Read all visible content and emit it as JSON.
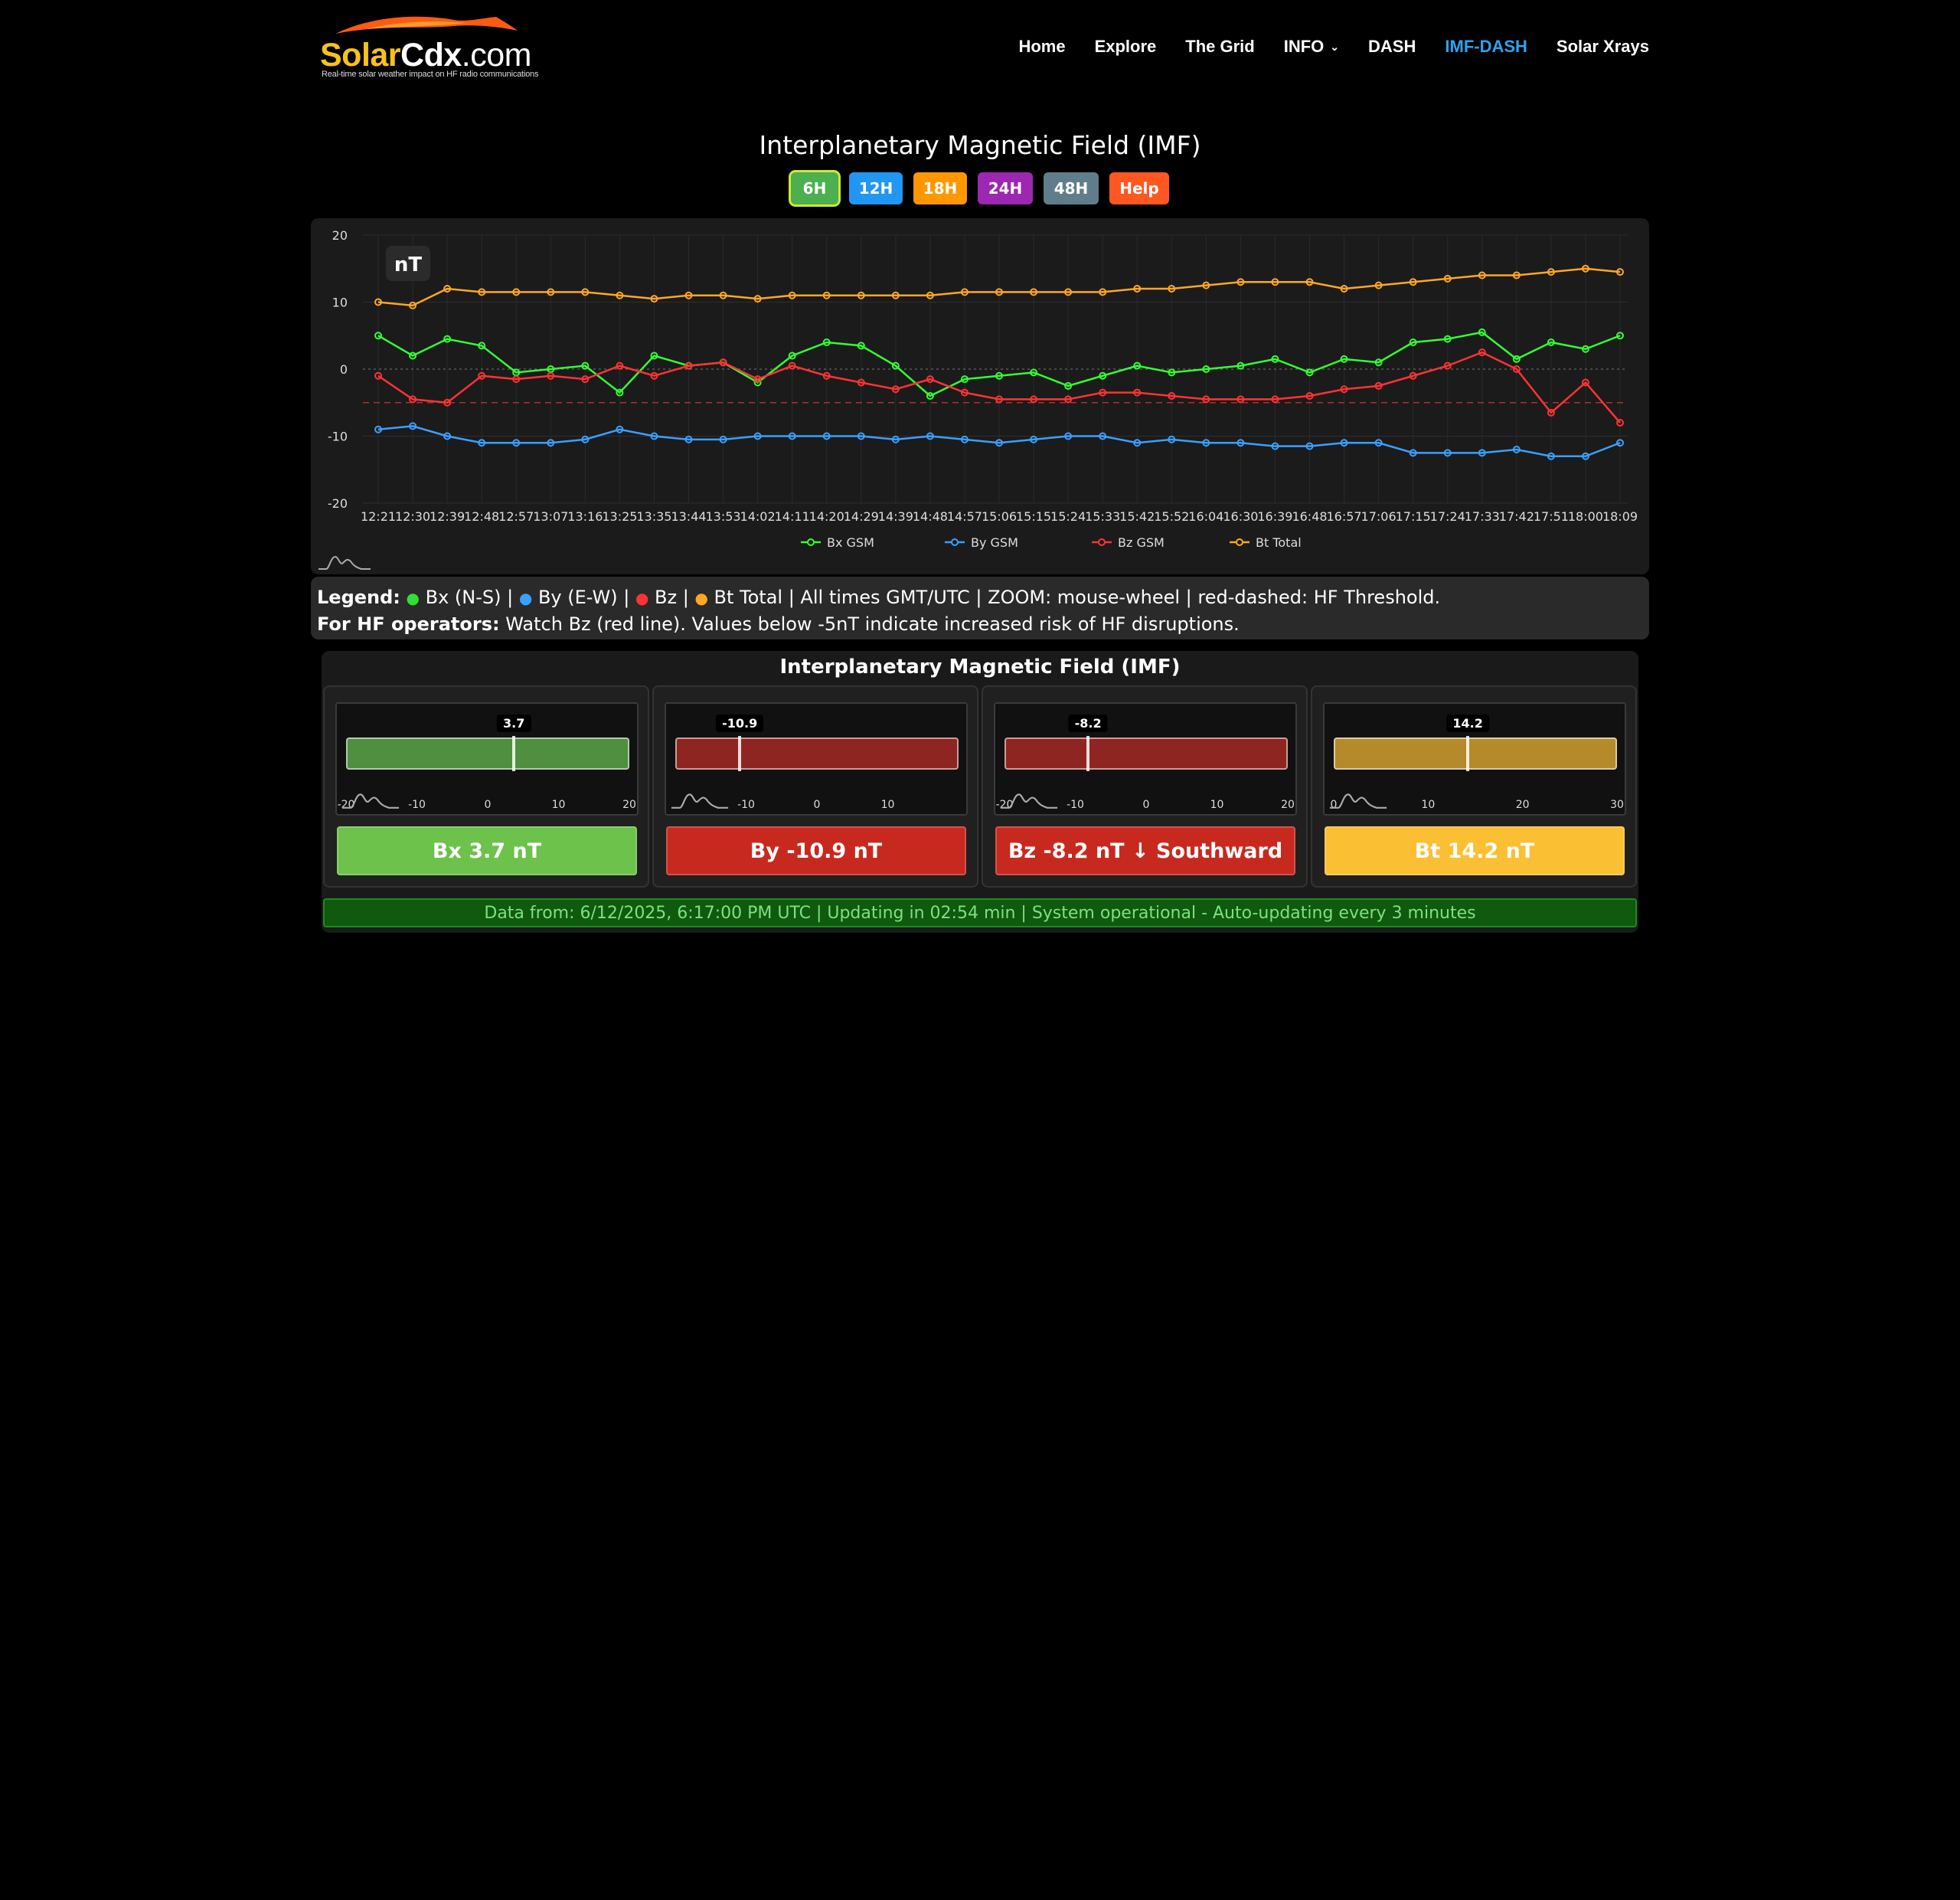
{
  "header": {
    "logo": {
      "solar": "Solar",
      "cdx": "Cdx",
      "com": ".com",
      "tagline": "Real-time solar weather impact on HF radio communications"
    },
    "nav": [
      {
        "label": "Home"
      },
      {
        "label": "Explore"
      },
      {
        "label": "The Grid"
      },
      {
        "label": "INFO"
      },
      {
        "label": "DASH"
      },
      {
        "label": "IMF-DASH",
        "active": true
      },
      {
        "label": "Solar Xrays"
      }
    ]
  },
  "page_title": "Interplanetary Magnetic Field (IMF)",
  "range_buttons": [
    {
      "label": "6H",
      "color": "#4caf50",
      "active": true
    },
    {
      "label": "12H",
      "color": "#2196f3"
    },
    {
      "label": "18H",
      "color": "#ff9800"
    },
    {
      "label": "24H",
      "color": "#9c27b0"
    },
    {
      "label": "48H",
      "color": "#607d8b"
    },
    {
      "label": "Help",
      "color": "#ff5722"
    }
  ],
  "chart_data": {
    "type": "line",
    "ylabel": "nT",
    "ylim": [
      -20,
      20
    ],
    "yticks": [
      20,
      10,
      0,
      -10,
      -20
    ],
    "hf_threshold": -5,
    "x": [
      "12:21",
      "12:30",
      "12:39",
      "12:48",
      "12:57",
      "13:07",
      "13:16",
      "13:25",
      "13:35",
      "13:44",
      "13:53",
      "14:02",
      "14:11",
      "14:20",
      "14:29",
      "14:39",
      "14:48",
      "14:57",
      "15:06",
      "15:15",
      "15:24",
      "15:33",
      "15:42",
      "15:52",
      "16:04",
      "16:30",
      "16:39",
      "16:48",
      "16:57",
      "17:06",
      "17:15",
      "17:24",
      "17:33",
      "17:42",
      "17:51",
      "18:00",
      "18:09"
    ],
    "series": [
      {
        "name": "Bx GSM",
        "color": "#33ff33",
        "values": [
          5.0,
          2.0,
          4.5,
          3.5,
          -0.5,
          0.0,
          0.5,
          -3.5,
          2.0,
          0.5,
          1.0,
          -2.0,
          2.0,
          4.0,
          3.5,
          0.5,
          -4.0,
          -1.5,
          -1.0,
          -0.5,
          -2.5,
          -1.0,
          0.5,
          -0.5,
          0.0,
          0.5,
          1.5,
          -0.5,
          1.5,
          1.0,
          4.0,
          4.5,
          5.5,
          1.5,
          4.0,
          3.0,
          5.0
        ]
      },
      {
        "name": "By GSM",
        "color": "#3aa0ff",
        "values": [
          -9.0,
          -8.5,
          -10.0,
          -11.0,
          -11.0,
          -11.0,
          -10.5,
          -9.0,
          -10.0,
          -10.5,
          -10.5,
          -10.0,
          -10.0,
          -10.0,
          -10.0,
          -10.5,
          -10.0,
          -10.5,
          -11.0,
          -10.5,
          -10.0,
          -10.0,
          -11.0,
          -10.5,
          -11.0,
          -11.0,
          -11.5,
          -11.5,
          -11.0,
          -11.0,
          -12.5,
          -12.5,
          -12.5,
          -12.0,
          -13.0,
          -13.0,
          -11.0
        ]
      },
      {
        "name": "Bz GSM",
        "color": "#ff3333",
        "values": [
          -1.0,
          -4.5,
          -5.0,
          -1.0,
          -1.5,
          -1.0,
          -1.5,
          0.5,
          -1.0,
          0.5,
          1.0,
          -1.5,
          0.5,
          -1.0,
          -2.0,
          -3.0,
          -1.5,
          -3.5,
          -4.5,
          -4.5,
          -4.5,
          -3.5,
          -3.5,
          -4.0,
          -4.5,
          -4.5,
          -4.5,
          -4.0,
          -3.0,
          -2.5,
          -1.0,
          0.5,
          2.5,
          0.0,
          -6.5,
          -2.0,
          -8.0
        ]
      },
      {
        "name": "Bt Total",
        "color": "#ffa726",
        "values": [
          10.0,
          9.5,
          12.0,
          11.5,
          11.5,
          11.5,
          11.5,
          11.0,
          10.5,
          11.0,
          11.0,
          10.5,
          11.0,
          11.0,
          11.0,
          11.0,
          11.0,
          11.5,
          11.5,
          11.5,
          11.5,
          11.5,
          12.0,
          12.0,
          12.5,
          13.0,
          13.0,
          13.0,
          12.0,
          12.5,
          13.0,
          13.5,
          14.0,
          14.0,
          14.5,
          15.0,
          14.5
        ]
      }
    ]
  },
  "legend_box": {
    "line1_label": "Legend:",
    "bx": "Bx (N-S) |",
    "by": "By (E-W) |",
    "bz": "Bz |",
    "rest": "Bt Total | All times GMT/UTC | ZOOM: mouse-wheel | red-dashed: HF Threshold.",
    "line2_label": "For HF operators:",
    "line2_text": "Watch Bz (red line). Values below -5nT indicate increased risk of HF disruptions."
  },
  "gauges": {
    "title": "Interplanetary Magnetic Field (IMF)",
    "items": [
      {
        "value": 3.7,
        "value_label": "3.7",
        "min": -20,
        "max": 20,
        "ticks": [
          "-20",
          "-10",
          "0",
          "10",
          "20"
        ],
        "tick_values": [
          -20,
          -10,
          0,
          10,
          20
        ],
        "bar_color": "#4f8f3f",
        "status": "Bx 3.7 nT",
        "status_bg": "#6cc24a",
        "status_fg": "#ffffff"
      },
      {
        "value": -10.9,
        "value_label": "-10.9",
        "min": -20,
        "max": 20,
        "ticks": [
          "-10",
          "0",
          "10"
        ],
        "tick_values": [
          -10,
          0,
          10
        ],
        "bar_color": "#8f2520",
        "status": "By -10.9 nT",
        "status_bg": "#c8291e",
        "status_fg": "#ffffff"
      },
      {
        "value": -8.2,
        "value_label": "-8.2",
        "min": -20,
        "max": 20,
        "ticks": [
          "-20",
          "-10",
          "0",
          "10",
          "20"
        ],
        "tick_values": [
          -20,
          -10,
          0,
          10,
          20
        ],
        "bar_color": "#8f2520",
        "status": "Bz -8.2 nT ↓ Southward",
        "status_bg": "#c8291e",
        "status_fg": "#ffffff"
      },
      {
        "value": 14.2,
        "value_label": "14.2",
        "min": 0,
        "max": 30,
        "ticks": [
          "0",
          "10",
          "20",
          "30"
        ],
        "tick_values": [
          0,
          10,
          20,
          30
        ],
        "bar_color": "#b58a2a",
        "status": "Bt 14.2 nT",
        "status_bg": "#fbbf33",
        "status_fg": "#ffffff"
      }
    ]
  },
  "status_bar": "Data from: 6/12/2025, 6:17:00 PM UTC | Updating in 02:54 min | System operational - Auto-updating every 3 minutes"
}
